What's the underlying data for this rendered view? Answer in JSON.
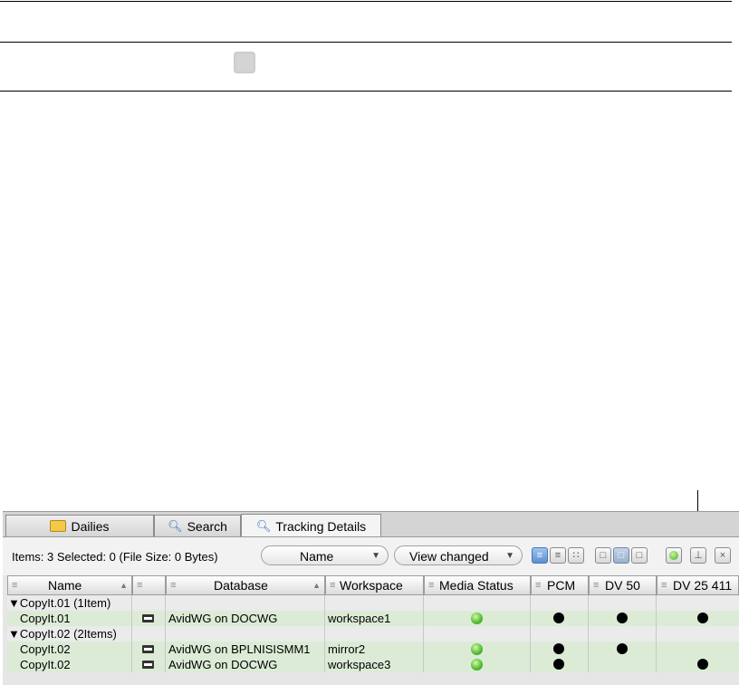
{
  "tabs": [
    {
      "label": "Dailies",
      "icon": "folder-icon"
    },
    {
      "label": "Search",
      "icon": "search-icon"
    },
    {
      "label": "Tracking Details",
      "icon": "search-icon"
    }
  ],
  "toolbar": {
    "info": "Items: 3 Selected: 0 (File Size: 0 Bytes)",
    "sort_dropdown": "Name",
    "view_dropdown": "View changed",
    "view_buttons": [
      "list-view-icon",
      "detail-view-icon",
      "thumbnail-view-icon"
    ],
    "pane_buttons": [
      "pane-left-icon",
      "pane-middle-icon",
      "pane-right-icon"
    ],
    "action_buttons": [
      "refresh-icon",
      "pin-icon",
      "close-icon"
    ],
    "close_glyph": "×"
  },
  "columns": [
    "Name",
    "",
    "Database",
    "Workspace",
    "Media Status",
    "PCM",
    "DV 50",
    "DV 25 411"
  ],
  "groups": [
    {
      "label": "▼CopyIt.01 (1Item)",
      "items": [
        {
          "name": "CopyIt.01",
          "database": "AvidWG on DOCWG",
          "workspace": "workspace1",
          "pcm": true,
          "dv50": true,
          "dv25": true
        }
      ]
    },
    {
      "label": "▼CopyIt.02 (2Items)",
      "items": [
        {
          "name": "CopyIt.02",
          "database": "AvidWG on BPLNISISMM1",
          "workspace": "mirror2",
          "pcm": true,
          "dv50": true,
          "dv25": false
        },
        {
          "name": "CopyIt.02",
          "database": "AvidWG on DOCWG",
          "workspace": "workspace3",
          "pcm": true,
          "dv50": false,
          "dv25": true
        }
      ]
    }
  ],
  "colors": {
    "item_row": "#dcebd6",
    "group_row": "#ebebeb",
    "status_green": "#58c032"
  }
}
